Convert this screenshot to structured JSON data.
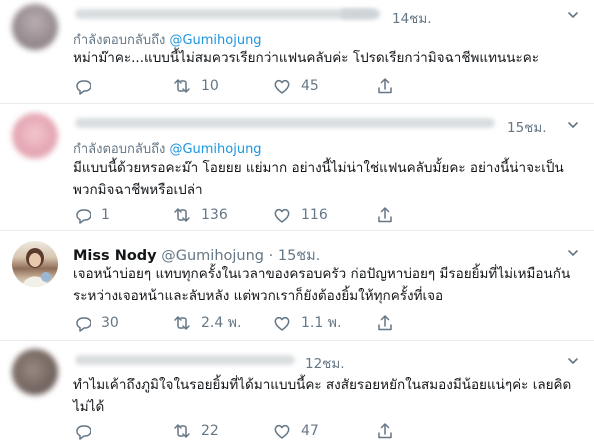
{
  "tweets": [
    {
      "time": "14ชม.",
      "reply_prefix": "กำลังตอบกลับถึง",
      "reply_to": "@Gumihojung",
      "body": "หม่าม๊าคะ...แบบนี้ไม่สมควรเรียกว่าแฟนคลับค่ะ โปรดเรียกว่ามิจฉาชีพแทนนะคะ",
      "replies": "",
      "retweets": "10",
      "likes": "45"
    },
    {
      "time": "15ชม.",
      "reply_prefix": "กำลังตอบกลับถึง",
      "reply_to": "@Gumihojung",
      "body": "มีแบบนี้ด้วยหรอคะม๊า โอยยย แย่มาก อย่างนี้ไม่น่าใช่แฟนคลับมั้ยคะ อย่างนี้น่าจะเป็นพวกมิจฉาชีพหรือเปล่า",
      "replies": "1",
      "retweets": "136",
      "likes": "116"
    },
    {
      "name": "Miss Nody",
      "handle": "@Gumihojung",
      "dot": "·",
      "time": "15ชม.",
      "body": "เจอหน้าบ่อยๆ แทบทุกครั้งในเวลาของครอบครัว ก่อปัญหาบ่อยๆ มีรอยยิ้มที่ไม่เหมือนกันระหว่างเจอหน้าและลับหลัง แต่พวกเราก็ยังต้องยิ้มให้ทุกครั้งที่เจอ",
      "replies": "30",
      "retweets": "2.4 พ.",
      "likes": "1.1 พ."
    },
    {
      "time": "12ชม.",
      "body": "ทำไมเค้าถึงภูมิใจในรอยยิ้มที่ได้มาแบบนี้คะ สงสัยรอยหยักในสมองมีน้อยแน่ๆค่ะ เลยคิดไม่ได้",
      "replies": "",
      "retweets": "22",
      "likes": "47"
    }
  ],
  "icons": [
    "reply-icon",
    "retweet-icon",
    "like-icon",
    "share-icon",
    "chevron-down-icon"
  ],
  "colors": {
    "text": "#14171a",
    "muted": "#657786",
    "link": "#1b95e0",
    "border": "#e6ecf0"
  }
}
